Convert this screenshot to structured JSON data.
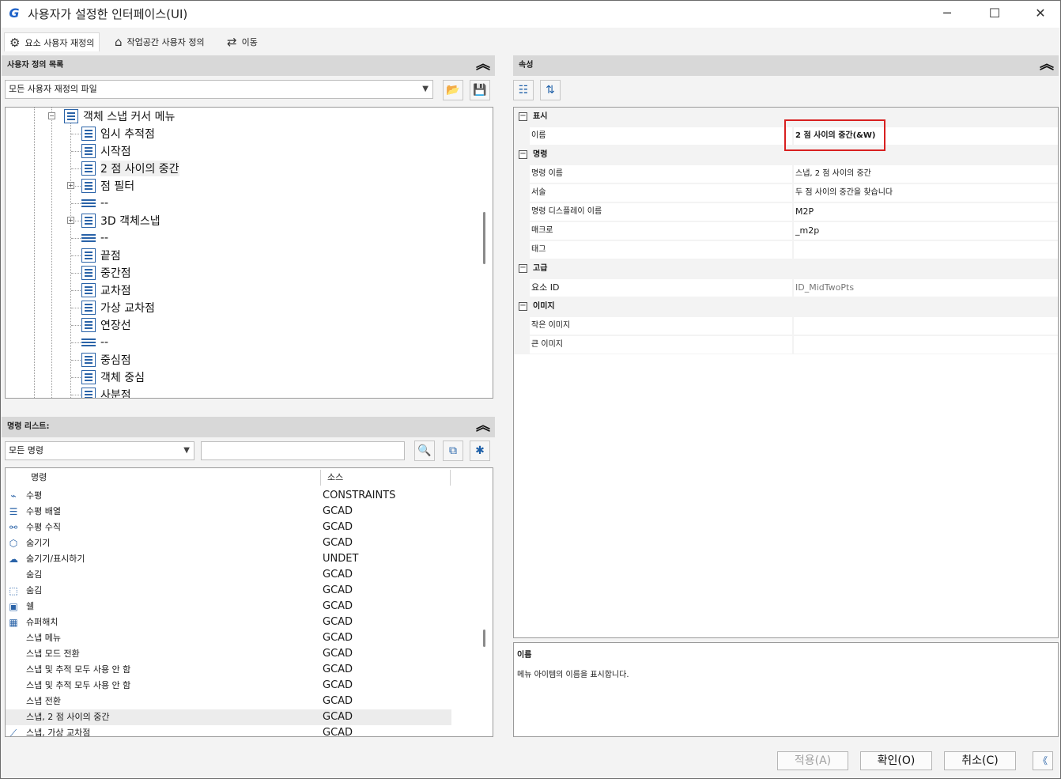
{
  "window": {
    "title": "사용자가 설정한 인터페이스(UI)",
    "minimize": "─",
    "maximize": "☐",
    "close": "✕"
  },
  "tabs": [
    {
      "label": "요소 사용자 재정의",
      "icon": "gear-icon"
    },
    {
      "label": "작업공간 사용자 정의",
      "icon": "home-icon"
    },
    {
      "label": "이동",
      "icon": "transfer-icon"
    }
  ],
  "custom_list": {
    "header": "사용자 정의 목록",
    "file_select": "모든 사용자 재정의 파일",
    "tree": [
      {
        "label": "객체 스냅 커서 메뉴",
        "level": "parent"
      },
      {
        "label": "임시 추적점"
      },
      {
        "label": "시작점"
      },
      {
        "label": "2 점 사이의 중간",
        "selected": true
      },
      {
        "label": "점 필터",
        "expandable": true
      },
      {
        "label": "--",
        "separator": true
      },
      {
        "label": "3D 객체스냅",
        "expandable": true
      },
      {
        "label": "--",
        "separator": true
      },
      {
        "label": "끝점"
      },
      {
        "label": "중간점"
      },
      {
        "label": "교차점"
      },
      {
        "label": "가상 교차점"
      },
      {
        "label": "연장선"
      },
      {
        "label": "--",
        "separator": true
      },
      {
        "label": "중심점"
      },
      {
        "label": "객체 중심"
      },
      {
        "label": "사분점"
      }
    ]
  },
  "command_list": {
    "header": "명령 리스트:",
    "filter": "모든 명령",
    "search_value": "",
    "columns": [
      "명령",
      "소스"
    ],
    "rows": [
      {
        "name": "수평",
        "source": "CONSTRAINTS"
      },
      {
        "name": "수평 배열",
        "source": "GCAD"
      },
      {
        "name": "수평 수직",
        "source": "GCAD"
      },
      {
        "name": "숨기기",
        "source": "GCAD"
      },
      {
        "name": "숨기기/표시하기",
        "source": "UNDET"
      },
      {
        "name": "숨김",
        "source": "GCAD"
      },
      {
        "name": "숨김",
        "source": "GCAD"
      },
      {
        "name": "쉘",
        "source": "GCAD"
      },
      {
        "name": "슈퍼해치",
        "source": "GCAD"
      },
      {
        "name": "스냅 메뉴",
        "source": "GCAD"
      },
      {
        "name": "스냅 모드 전환",
        "source": "GCAD"
      },
      {
        "name": "스냅 및 추적 모두 사용 안 함",
        "source": "GCAD"
      },
      {
        "name": "스냅 및 추적 모두 사용 안 함",
        "source": "GCAD"
      },
      {
        "name": "스냅 전환",
        "source": "GCAD"
      },
      {
        "name": "스냅, 2 점 사이의 중간",
        "source": "GCAD",
        "selected": true
      },
      {
        "name": "스냅, 가상 교차점",
        "source": "GCAD"
      }
    ]
  },
  "properties": {
    "header": "속성",
    "categories": {
      "display": "표시",
      "command": "명령",
      "advanced": "고급",
      "image": "이미지"
    },
    "rows": {
      "name_key": "이름",
      "name_value": "2 점 사이의 중간(&W)",
      "cmd_name_key": "명령 이름",
      "cmd_name_value": "스냅, 2 점 사이의 중간",
      "desc_key": "서술",
      "desc_value": "두 점 사이의 중간을 찾습니다",
      "cmd_display_key": "명령 디스플레이 이름",
      "cmd_display_value": "M2P",
      "macro_key": "매크로",
      "macro_value": "_m2p",
      "tag_key": "태그",
      "tag_value": "",
      "element_id_key": "요소 ID",
      "element_id_value": "ID_MidTwoPts",
      "small_image_key": "작은 이미지",
      "small_image_value": "",
      "large_image_key": "큰 이미지",
      "large_image_value": ""
    },
    "description": {
      "title": "이름",
      "text": "메뉴 아이템의 이름을 표시합니다."
    }
  },
  "buttons": {
    "apply": "적용(A)",
    "ok": "확인(O)",
    "cancel": "취소(C)",
    "collapse": "《"
  }
}
